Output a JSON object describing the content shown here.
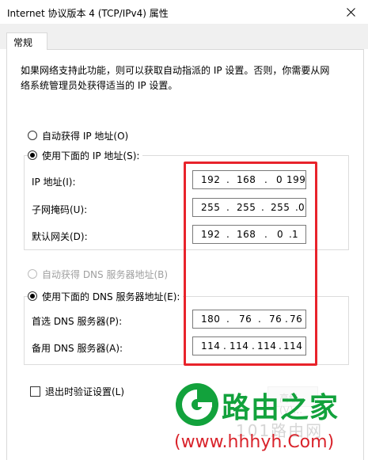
{
  "window": {
    "title": "Internet 协议版本 4 (TCP/IPv4) 属性"
  },
  "tabs": [
    {
      "label": "常规"
    }
  ],
  "description": "如果网络支持此功能，则可以获取自动指派的 IP 设置。否则，你需要从网络系统管理员处获得适当的 IP 设置。",
  "ip": {
    "auto_label": "自动获得 IP 地址(O)",
    "manual_label": "使用下面的 IP 地址(S):",
    "mode": "manual",
    "address_label": "IP 地址(I):",
    "address": [
      "192",
      "168",
      "0",
      "199"
    ],
    "subnet_label": "子网掩码(U):",
    "subnet": [
      "255",
      "255",
      "255",
      "0"
    ],
    "gateway_label": "默认网关(D):",
    "gateway": [
      "192",
      "168",
      "0",
      "1"
    ]
  },
  "dns": {
    "auto_label": "自动获得 DNS 服务器地址(B)",
    "manual_label": "使用下面的 DNS 服务器地址(E):",
    "mode": "manual",
    "preferred_label": "首选 DNS 服务器(P):",
    "preferred": [
      "180",
      "76",
      "76",
      "76"
    ],
    "alternate_label": "备用 DNS 服务器(A):",
    "alternate": [
      "114",
      "114",
      "114",
      "114"
    ]
  },
  "validate_on_exit": {
    "label": "退出时验证设置(L)",
    "checked": false
  },
  "advanced_button": {
    "label": "高级(V)..."
  },
  "watermark": {
    "brand": "路由之家",
    "faint_text": "101路由网",
    "url": "(www.hhhyh.Com)"
  },
  "colors": {
    "highlight": "#e8232b",
    "brand_green": "#12a23c",
    "brand_red": "#d9232b"
  }
}
